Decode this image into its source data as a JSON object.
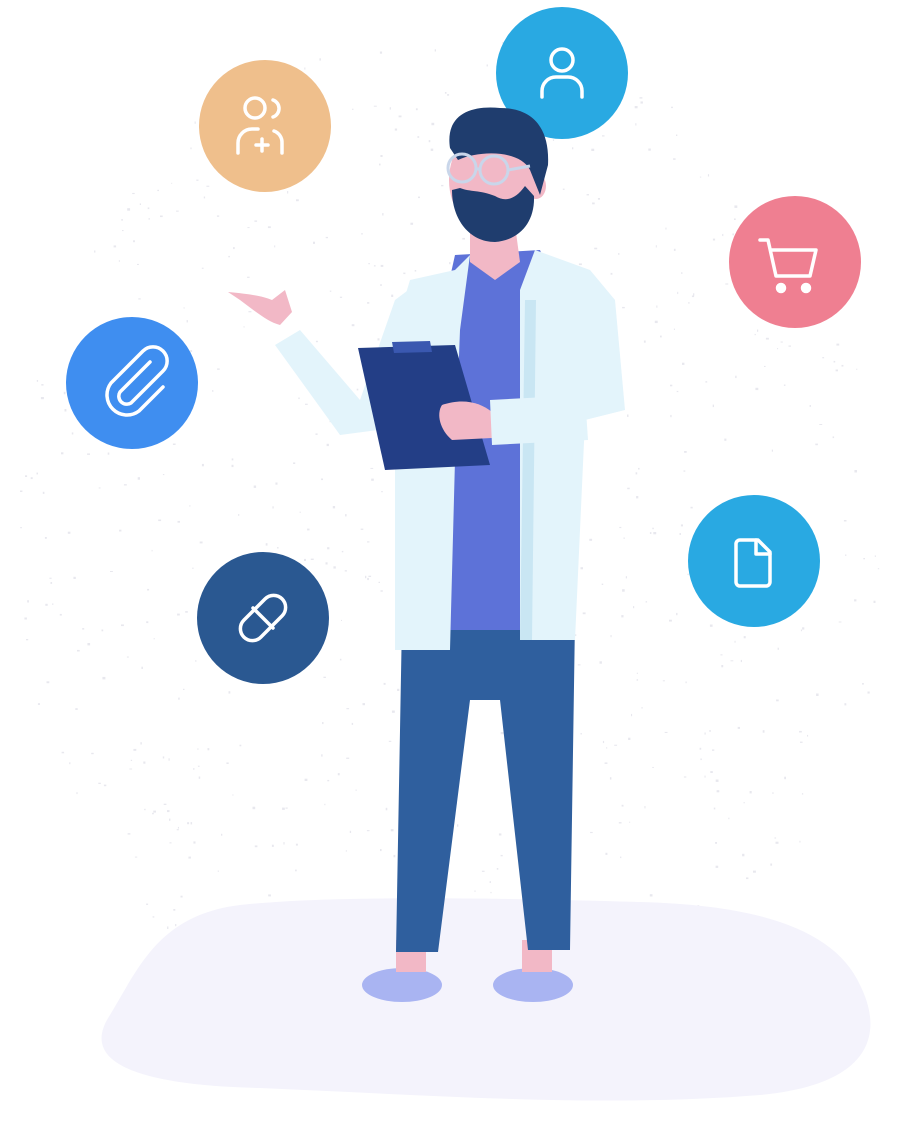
{
  "colors": {
    "background": "#ffffff",
    "ground": "#f4f3fc",
    "speckle": "#e8e8ee",
    "coat": "#e3f4fb",
    "coat_shadow": "#c9e6f3",
    "scrubs": "#5d72d8",
    "pants": "#2f5f9e",
    "skin": "#f2b8c6",
    "hair": "#1f3d6e",
    "shoes": "#a9b4f2",
    "clipboard": "#233e86",
    "clipboard_clip": "#3a58b0",
    "glasses": "#c9d6ea"
  },
  "icons": [
    {
      "name": "add-users-icon",
      "color": "#efbf8c"
    },
    {
      "name": "user-icon",
      "color": "#29a9e2"
    },
    {
      "name": "cart-icon",
      "color": "#ef7f91"
    },
    {
      "name": "paperclip-icon",
      "color": "#3f8ef0"
    },
    {
      "name": "pill-icon",
      "color": "#2a5891"
    },
    {
      "name": "document-icon",
      "color": "#29a9e2"
    }
  ]
}
